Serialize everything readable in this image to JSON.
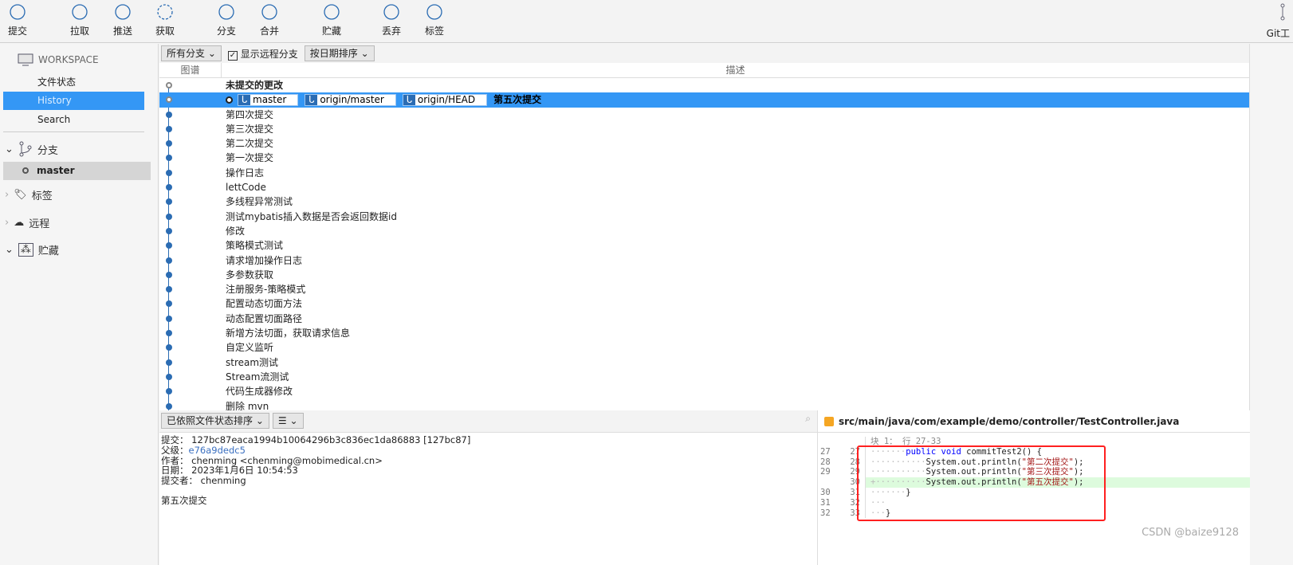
{
  "toolbar": {
    "items": [
      {
        "label": "提交",
        "icon": "plus-circle-icon"
      },
      {
        "label": "拉取",
        "icon": "arrow-down-circle-icon"
      },
      {
        "label": "推送",
        "icon": "arrow-up-circle-icon"
      },
      {
        "label": "获取",
        "icon": "fetch-icon"
      },
      {
        "label": "分支",
        "icon": "branch-icon"
      },
      {
        "label": "合并",
        "icon": "merge-icon"
      },
      {
        "label": "贮藏",
        "icon": "stash-icon"
      },
      {
        "label": "丢弃",
        "icon": "discard-icon"
      },
      {
        "label": "标签",
        "icon": "tag-icon"
      }
    ],
    "git_label": "Git工"
  },
  "sidebar": {
    "workspace": "WORKSPACE",
    "items": [
      {
        "label": "文件状态"
      },
      {
        "label": "History"
      },
      {
        "label": "Search"
      }
    ],
    "branches_label": "分支",
    "branch_master": "master",
    "tags_label": "标签",
    "remote_label": "远程",
    "stash_label": "贮藏"
  },
  "filter": {
    "branches": "所有分支",
    "show_remote": "显示远程分支",
    "sort": "按日期排序"
  },
  "columns": {
    "graph": "图谱",
    "desc": "描述"
  },
  "commits": {
    "uncommitted": "未提交的更改",
    "selected": {
      "refs": [
        "master",
        "origin/master",
        "origin/HEAD"
      ],
      "message": "第五次提交"
    },
    "list": [
      "第四次提交",
      "第三次提交",
      "第二次提交",
      "第一次提交",
      "操作日志",
      "lettCode",
      "多线程异常测试",
      "测试mybatis插入数据是否会返回数据id",
      "修改",
      "策略模式测试",
      "请求增加操作日志",
      "多参数获取",
      "注册服务-策略模式",
      "配置动态切面方法",
      "动态配置切面路径",
      "新增方法切面，获取请求信息",
      "自定义监听",
      "stream测试",
      "Stream流测试",
      "代码生成器修改",
      "删除 mvn"
    ]
  },
  "details": {
    "sort": "已依照文件状态排序",
    "commit": "提交： 127bc87eaca1994b10064296b3c836ec1da86883 [127bc87]",
    "parent_label": "父级：",
    "parent": "e76a9dedc5",
    "author": "作者： chenming <chenming@mobimedical.cn>",
    "date": "日期： 2023年1月6日 10:54:53",
    "committer": "提交者： chenming",
    "message": "第五次提交"
  },
  "diff": {
    "file": "src/main/java/com/example/demo/controller/TestController.java",
    "hunk": "块 1： 行 27-33",
    "lines": [
      {
        "old": "27",
        "new": "27",
        "pre": "·······",
        "kw": "public void",
        "rest": " commitTest2() {",
        "str": "",
        "end": "",
        "added": false
      },
      {
        "old": "28",
        "new": "28",
        "pre": "···········",
        "kw": "",
        "rest": "System.out.println(",
        "str": "\"第二次提交\"",
        "end": ");",
        "added": false
      },
      {
        "old": "29",
        "new": "29",
        "pre": "···········",
        "kw": "",
        "rest": "System.out.println(",
        "str": "\"第三次提交\"",
        "end": ");",
        "added": false
      },
      {
        "old": "",
        "new": "30",
        "pre": "+··········",
        "kw": "",
        "rest": "System.out.println(",
        "str": "\"第五次提交\"",
        "end": ");",
        "added": true
      },
      {
        "old": "30",
        "new": "31",
        "pre": "·······",
        "kw": "",
        "rest": "}",
        "str": "",
        "end": "",
        "added": false
      },
      {
        "old": "31",
        "new": "32",
        "pre": "···",
        "kw": "",
        "rest": "",
        "str": "",
        "end": "",
        "added": false
      },
      {
        "old": "32",
        "new": "33",
        "pre": "···",
        "kw": "",
        "rest": "}",
        "str": "",
        "end": "",
        "added": false
      }
    ]
  },
  "watermark": "CSDN @baize9128",
  "colors": {
    "accent": "#3497f5",
    "highlight_box": "#ff2020",
    "added_line": "#ddfbdd"
  }
}
